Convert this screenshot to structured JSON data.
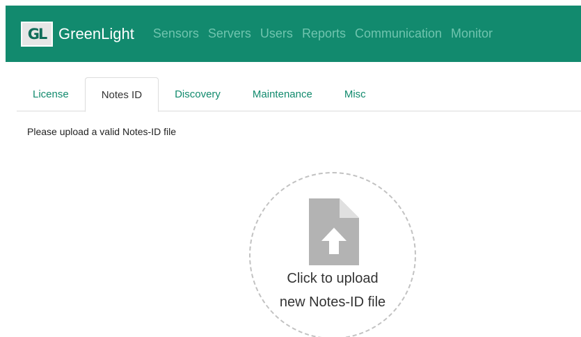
{
  "app": {
    "logo_text": "GL",
    "name": "GreenLight"
  },
  "nav": {
    "items": [
      {
        "label": "Sensors"
      },
      {
        "label": "Servers"
      },
      {
        "label": "Users"
      },
      {
        "label": "Reports"
      },
      {
        "label": "Communication"
      },
      {
        "label": "Monitor"
      }
    ]
  },
  "tabs": [
    {
      "label": "License",
      "active": false
    },
    {
      "label": "Notes ID",
      "active": true
    },
    {
      "label": "Discovery",
      "active": false
    },
    {
      "label": "Maintenance",
      "active": false
    },
    {
      "label": "Misc",
      "active": false
    }
  ],
  "content": {
    "instruction": "Please upload a valid Notes-ID file",
    "upload": {
      "line1": "Click to upload",
      "line2": "new Notes-ID file",
      "icon": "file-upload-icon"
    }
  },
  "colors": {
    "navbar": "#128a6e",
    "nav_link": "#6fc4ae",
    "tab_link": "#118a6d",
    "icon_gray": "#b3b3b3"
  }
}
